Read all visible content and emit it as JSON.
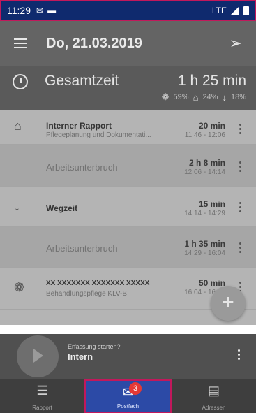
{
  "statusbar": {
    "time": "11:29",
    "network": "LTE"
  },
  "appbar": {
    "date": "Do, 21.03.2019"
  },
  "total": {
    "label": "Gesamtzeit",
    "value": "1 h 25 min",
    "shares": [
      {
        "icon": "care-icon",
        "pct": "59%"
      },
      {
        "icon": "house-icon",
        "pct": "24%"
      },
      {
        "icon": "arrow-down-icon",
        "pct": "18%"
      }
    ]
  },
  "rows": [
    {
      "icon": "house-icon",
      "title": "Interner Rapport",
      "sub": "Pflegeplanung und Dokumentati...",
      "duration": "20 min",
      "span": "11:46 - 12:06"
    },
    {
      "pause": "Arbeitsunterbruch",
      "duration": "2 h 8 min",
      "span": "12:06 - 14:14"
    },
    {
      "icon": "arrow-down-icon",
      "title": "Wegzeit",
      "duration": "15 min",
      "span": "14:14 - 14:29"
    },
    {
      "pause": "Arbeitsunterbruch",
      "duration": "1 h 35 min",
      "span": "14:29 - 16:04"
    },
    {
      "icon": "care-icon",
      "title": "XX XXXXXXX XXXXXXX XXXXX",
      "sub": "Behandlungspflege KLV-B",
      "duration": "50 min",
      "span": "16:04 - 16:54"
    }
  ],
  "starter": {
    "question": "Erfassung starten?",
    "mode": "Intern"
  },
  "tabs": [
    {
      "label": "Rapport"
    },
    {
      "label": "Postfach",
      "badge": "3"
    },
    {
      "label": "Adressen"
    }
  ]
}
